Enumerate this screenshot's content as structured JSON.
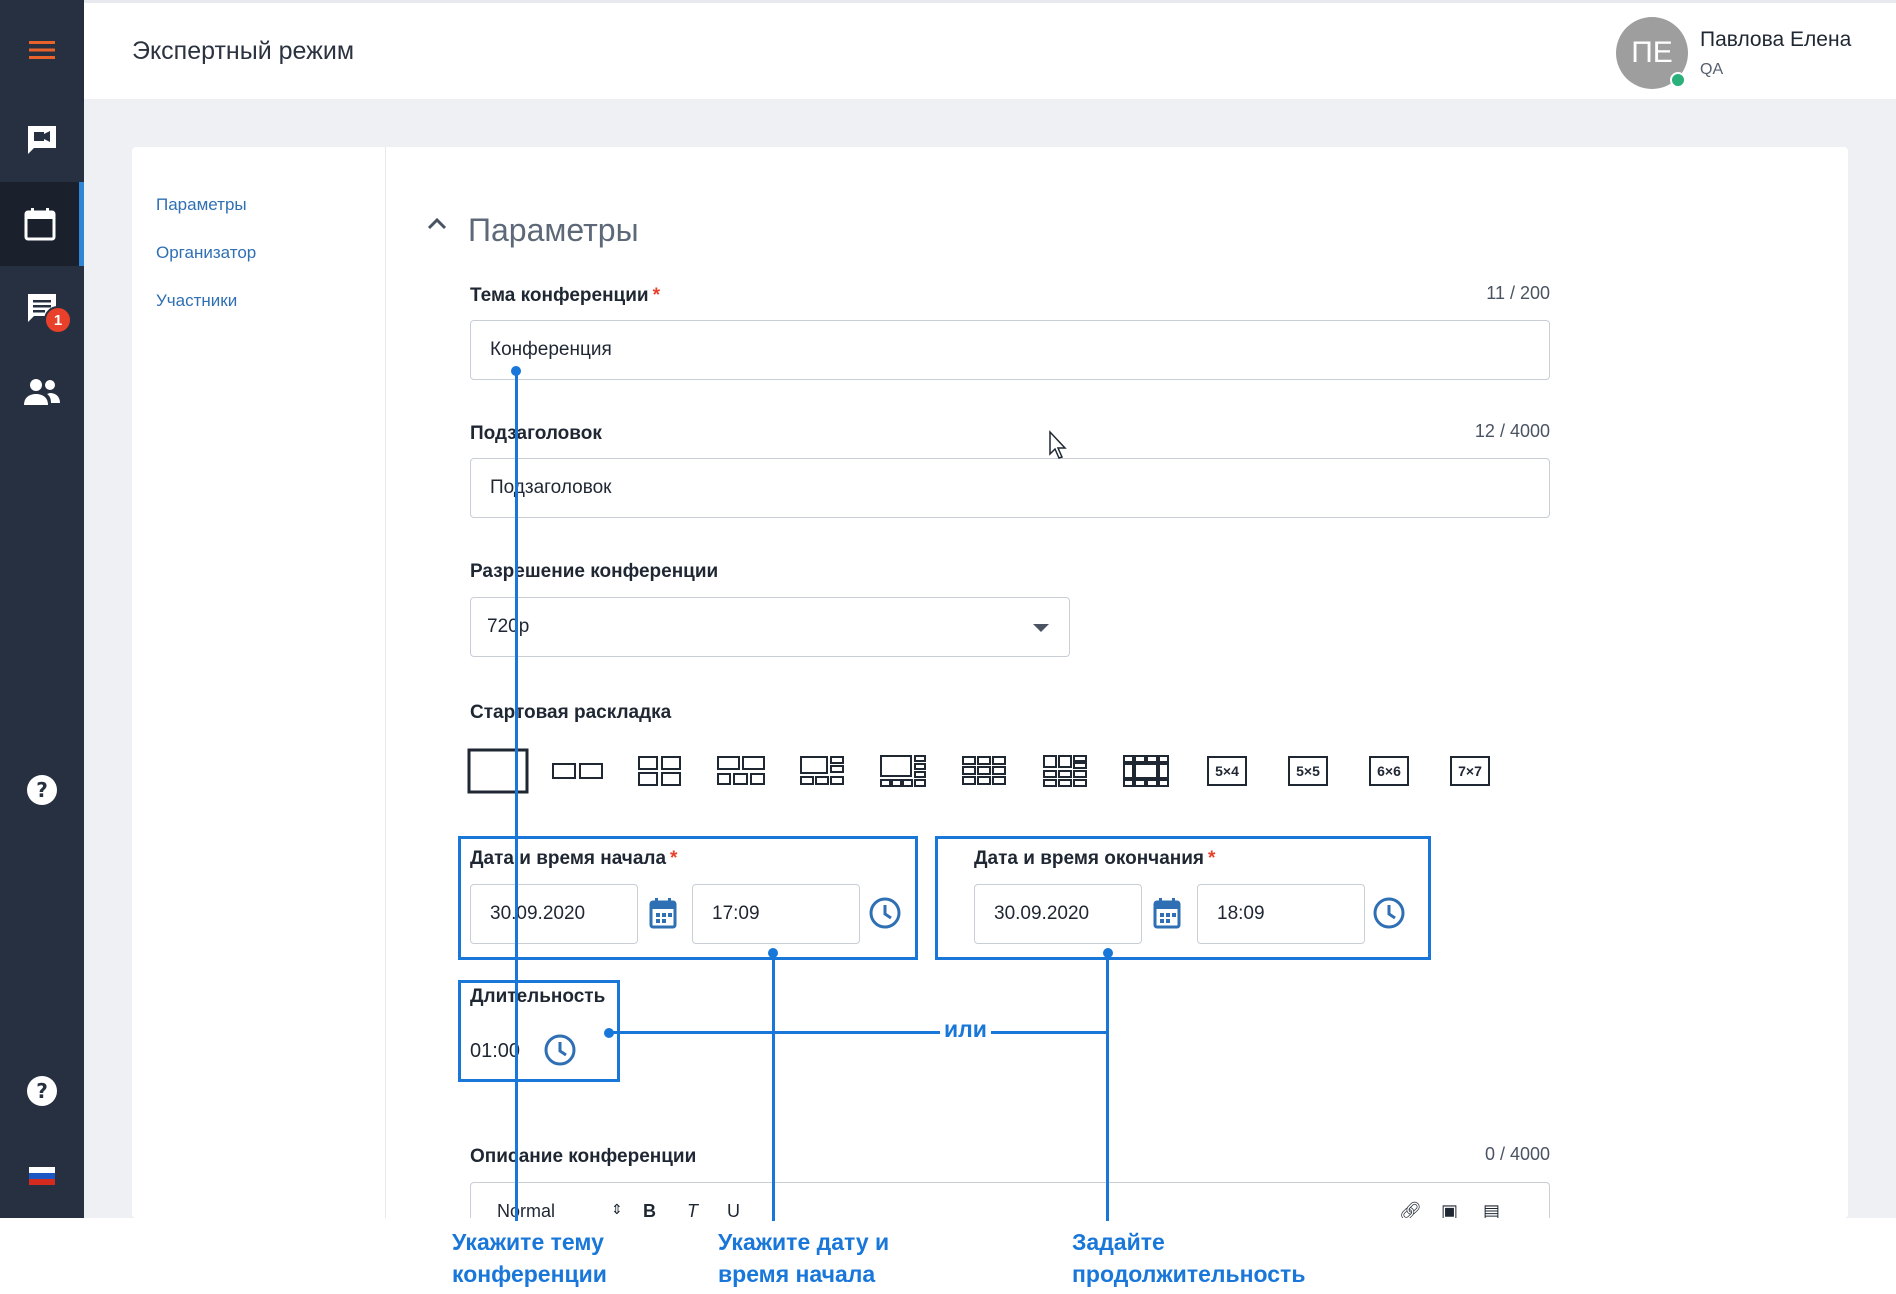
{
  "colors": {
    "sidebar_bg": "#263040",
    "accent": "#2f86d6",
    "annotation": "#1877d9",
    "required": "#e8402a",
    "badge": "#e8402a",
    "online": "#2ab07a"
  },
  "sidebar": {
    "items": [
      {
        "icon": "hamburger-menu-icon"
      },
      {
        "icon": "video-chat-icon"
      },
      {
        "icon": "calendar-icon",
        "active": true
      },
      {
        "icon": "chat-icon",
        "badge": "1"
      },
      {
        "icon": "contacts-icon"
      },
      {
        "icon": "help-icon"
      },
      {
        "icon": "help-icon"
      },
      {
        "icon": "russian-flag-icon"
      }
    ],
    "chat_badge": "1"
  },
  "header": {
    "title": "Экспертный режим",
    "avatar_initials": "ПЕ",
    "user_name": "Павлова Елена",
    "user_role": "QA"
  },
  "nav": {
    "items": [
      "Параметры",
      "Организатор",
      "Участники"
    ]
  },
  "section": {
    "title": "Параметры"
  },
  "form": {
    "topic": {
      "label": "Тема конференции",
      "required": "*",
      "value": "Конференция",
      "counter": "11 / 200"
    },
    "subtitle": {
      "label": "Подзаголовок",
      "value": "Подзаголовок",
      "counter": "12 / 4000"
    },
    "resolution": {
      "label": "Разрешение конференции",
      "value": "720p"
    },
    "layout": {
      "label": "Стартовая раскладка",
      "selected_index": 0,
      "options": [
        "1",
        "2",
        "2x2",
        "2+3",
        "3+3",
        "1+5",
        "3x3",
        "2+8",
        "4x3",
        "5×4",
        "5×5",
        "6×6",
        "7×7"
      ]
    },
    "start": {
      "label": "Дата и время начала",
      "required": "*",
      "date": "30.09.2020",
      "time": "17:09"
    },
    "end": {
      "label": "Дата и время окончания",
      "required": "*",
      "date": "30.09.2020",
      "time": "18:09"
    },
    "duration": {
      "label": "Длительность",
      "value": "01:00"
    },
    "description": {
      "label": "Описание конференции",
      "counter": "0 / 4000"
    },
    "editor": {
      "format": "Normal",
      "bold": "B",
      "italic": "T",
      "underline": "U"
    }
  },
  "annotations": {
    "or": "или",
    "topic_line1": "Укажите тему",
    "topic_line2": "конференции",
    "start_line1": "Укажите дату и",
    "start_line2": "время начала",
    "duration_line1": "Задайте",
    "duration_line2": "продолжительность"
  }
}
